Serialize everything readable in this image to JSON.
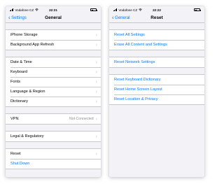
{
  "left": {
    "status": {
      "carrier": "Vodafone CZ",
      "time": "22:21"
    },
    "nav": {
      "back_label": "Settings",
      "title": "General"
    },
    "groups": [
      [
        {
          "label": "iPhone Storage"
        },
        {
          "label": "Background App Refresh"
        }
      ],
      [
        {
          "label": "Date & Time"
        },
        {
          "label": "Keyboard"
        },
        {
          "label": "Fonts"
        },
        {
          "label": "Language & Region"
        },
        {
          "label": "Dictionary"
        }
      ],
      [
        {
          "label": "VPN",
          "detail": "Not Connected"
        }
      ],
      [
        {
          "label": "Legal & Regulatory"
        }
      ],
      [
        {
          "label": "Reset"
        },
        {
          "label": "Shut Down"
        }
      ]
    ]
  },
  "right": {
    "status": {
      "carrier": "Vodafone CZ",
      "time": "22:22"
    },
    "nav": {
      "back_label": "General",
      "title": "Reset"
    },
    "groups": [
      [
        {
          "label": "Reset All Settings"
        },
        {
          "label": "Erase All Content and Settings"
        }
      ],
      [
        {
          "label": "Reset Network Settings"
        }
      ],
      [
        {
          "label": "Reset Keyboard Dictionary"
        },
        {
          "label": "Reset Home Screen Layout"
        },
        {
          "label": "Reset Location & Privacy"
        }
      ]
    ]
  },
  "icons": {
    "back": "chevron-left-icon",
    "disclosure": "chevron-right-icon",
    "wifi": "wifi-icon",
    "battery": "battery-icon",
    "signal": "signal-icon"
  },
  "colors": {
    "accent": "#007aff",
    "background": "#f2f2f7",
    "separator": "#c8c7cc",
    "secondary_text": "#8e8e93"
  }
}
